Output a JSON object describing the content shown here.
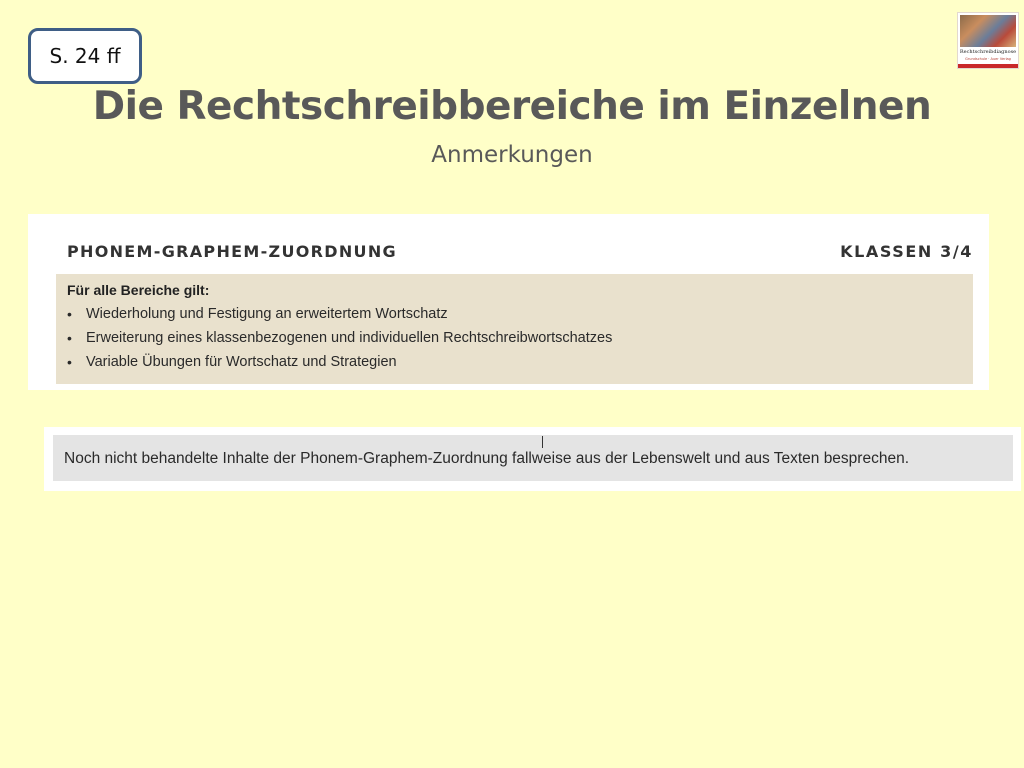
{
  "badge": {
    "label": "S. 24 ff"
  },
  "cover": {
    "title": "Rechtschreibdiagnose",
    "subtitle": "Grundschule · Auer Verlag"
  },
  "header": {
    "title": "Die Rechtschreibbereiche im Einzelnen",
    "subtitle": "Anmerkungen"
  },
  "card_top": {
    "left_heading": "PHONEM-GRAPHEM-ZUORDNUNG",
    "right_heading": "KLASSEN 3/4",
    "rule_heading": "Für alle Bereiche gilt:",
    "items": [
      "Wiederholung und Festigung an erweitertem Wortschatz",
      "Erweiterung eines klassenbezogenen und individuellen Rechtschreibwortschatzes",
      "Variable Übungen für Wortschatz und Strategien"
    ],
    "bullet": "•"
  },
  "card_bottom": {
    "note": "Noch nicht behandelte Inhalte der Phonem-Graphem-Zuordnung fallweise aus der Lebenswelt und aus Texten besprechen."
  },
  "colors": {
    "background": "#ffffc8",
    "badge_border": "#3f5e86",
    "title": "#595959",
    "rule_box": "#e9e1cd",
    "note_box": "#e4e4e4"
  }
}
